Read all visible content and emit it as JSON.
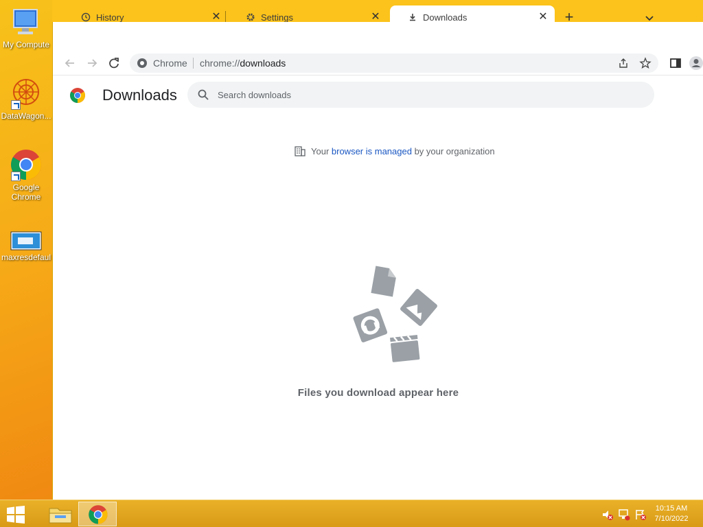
{
  "desktop": {
    "icons": [
      {
        "label": "My Compute"
      },
      {
        "label": "DataWagon..."
      },
      {
        "label": "Google Chrome"
      },
      {
        "label": "maxresdefaul"
      }
    ]
  },
  "browser": {
    "tabs": [
      {
        "title": "History",
        "icon": "history-icon"
      },
      {
        "title": "Settings",
        "icon": "gear-icon"
      },
      {
        "title": "Downloads",
        "icon": "download-icon",
        "active": true
      }
    ],
    "omnibox": {
      "site_label": "Chrome",
      "url_scheme": "chrome://",
      "url_path": "downloads"
    }
  },
  "downloads_page": {
    "title": "Downloads",
    "search_placeholder": "Search downloads",
    "managed_prefix": "Your ",
    "managed_link": "browser is managed",
    "managed_suffix": " by your organization",
    "empty_message": "Files you download appear here"
  },
  "taskbar": {
    "time": "10:15 AM",
    "date": "7/10/2022"
  },
  "colors": {
    "accent_link": "#1a57c2",
    "taskbar": "#d99a16",
    "desktop": "#f6a917"
  }
}
